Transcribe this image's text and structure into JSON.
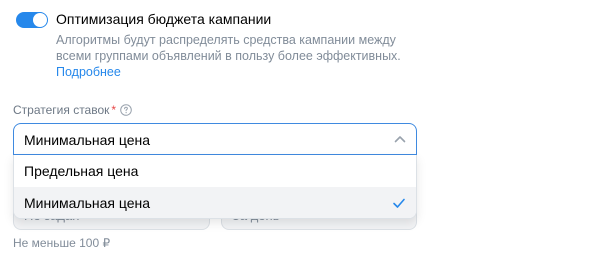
{
  "budget_optimization": {
    "enabled": true,
    "title": "Оптимизация бюджета кампании",
    "description": "Алгоритмы будут распределять средства кампании между всеми группами объявлений в пользу более эффективных.",
    "more_link": "Подробнее"
  },
  "bid_strategy": {
    "label": "Стратегия ставок",
    "required_mark": "*",
    "selected_value": "Минимальная цена",
    "options": [
      {
        "label": "Предельная цена",
        "selected": false
      },
      {
        "label": "Минимальная цена",
        "selected": true
      }
    ]
  },
  "obscured_fields": {
    "left_text": "Не задан",
    "right_text": "За день"
  },
  "hint": "Не меньше 100 ₽",
  "colors": {
    "accent": "#2688eb",
    "border_focus": "#3f8ae0",
    "secondary_text": "#818c99",
    "required": "#e64646"
  }
}
